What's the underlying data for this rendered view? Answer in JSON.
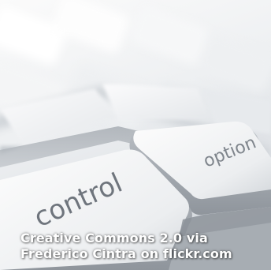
{
  "photo": {
    "key_labels": {
      "control": "control",
      "option": "option"
    },
    "caption": {
      "line1": "Creative Commons 2.0 via",
      "line2": "Frederico Cintra on flickr.com"
    }
  },
  "colors": {
    "key_face": "#f2f3f4",
    "key_label": "#7a8088",
    "caption": "#ffffff"
  }
}
